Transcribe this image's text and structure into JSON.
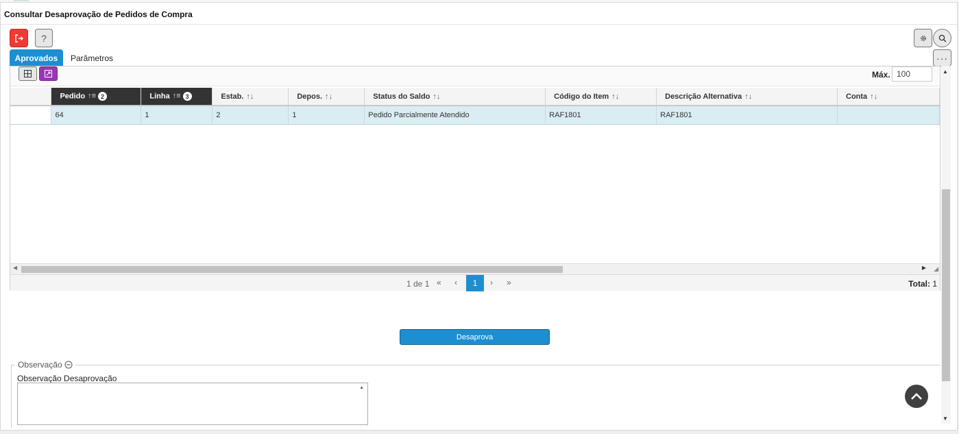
{
  "window": {
    "title": "Consultar Desaprovação de Pedidos de Compra"
  },
  "toolbar": {
    "exit_icon": "exit-icon",
    "help_label": "?",
    "gear_icon": "gear-icon",
    "search_icon": "search-icon",
    "more_label": "···"
  },
  "tabs": [
    {
      "label": "Aprovados",
      "active": true
    },
    {
      "label": "Parâmetros",
      "active": false
    }
  ],
  "grid_toolbar": {
    "max_label": "Máx.",
    "max_value": "100"
  },
  "table": {
    "columns": [
      {
        "label": "",
        "sorted": false
      },
      {
        "label": "Pedido",
        "sorted": true,
        "sort_order": "2"
      },
      {
        "label": "Linha",
        "sorted": true,
        "sort_order": "3"
      },
      {
        "label": "Estab.",
        "sorted": false
      },
      {
        "label": "Depos.",
        "sorted": false
      },
      {
        "label": "Status do Saldo",
        "sorted": false
      },
      {
        "label": "Código do Item",
        "sorted": false
      },
      {
        "label": "Descrição Alternativa",
        "sorted": false
      },
      {
        "label": "Conta",
        "sorted": false
      }
    ],
    "rows": [
      [
        "",
        "64",
        "1",
        "2",
        "1",
        "Pedido Parcialmente Atendido",
        "RAF1801",
        "RAF1801",
        ""
      ]
    ]
  },
  "pagination": {
    "info": "1 de 1",
    "first": "«",
    "prev": "‹",
    "current": "1",
    "next": "›",
    "last": "»",
    "total_label": "Total:",
    "total_value": "1"
  },
  "actions": {
    "desaprova_label": "Desaprova"
  },
  "observacao": {
    "legend": "Observação",
    "field_label": "Observação Desaprovação",
    "field_value": ""
  },
  "colors": {
    "primary": "#1d8fd0",
    "danger": "#ef3b33",
    "export": "#9a35b8",
    "selected_row": "#d9edf3",
    "sorted_header": "#333333"
  }
}
